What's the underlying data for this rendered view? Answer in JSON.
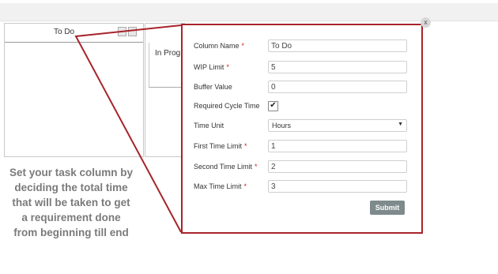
{
  "board": {
    "column1_title": "To Do",
    "column2_title": "In Prog"
  },
  "caption": {
    "lines": [
      "Set your task column by",
      "deciding the total time",
      "that will be taken to get",
      "a requirement done",
      "from beginning till end"
    ]
  },
  "dialog": {
    "close_label": "x",
    "fields": [
      {
        "label": "Column Name",
        "required": true,
        "value": "To Do"
      },
      {
        "label": "WIP Limit",
        "required": true,
        "value": "5"
      },
      {
        "label": "Buffer Value",
        "required": false,
        "value": "0"
      },
      {
        "label": "Required Cycle Time",
        "required": false,
        "checked": true
      },
      {
        "label": "Time Unit",
        "required": false,
        "value": "Hours"
      },
      {
        "label": "First Time Limit",
        "required": true,
        "value": "1"
      },
      {
        "label": "Second Time Limit",
        "required": true,
        "value": "2"
      },
      {
        "label": "Max Time Limit",
        "required": true,
        "value": "3"
      }
    ],
    "submit_label": "Submit",
    "required_mark": "*",
    "check_mark": "✔",
    "chevron": "▼"
  },
  "colors": {
    "callout_border": "#a8232a",
    "submit_bg": "#7e8a8b"
  }
}
